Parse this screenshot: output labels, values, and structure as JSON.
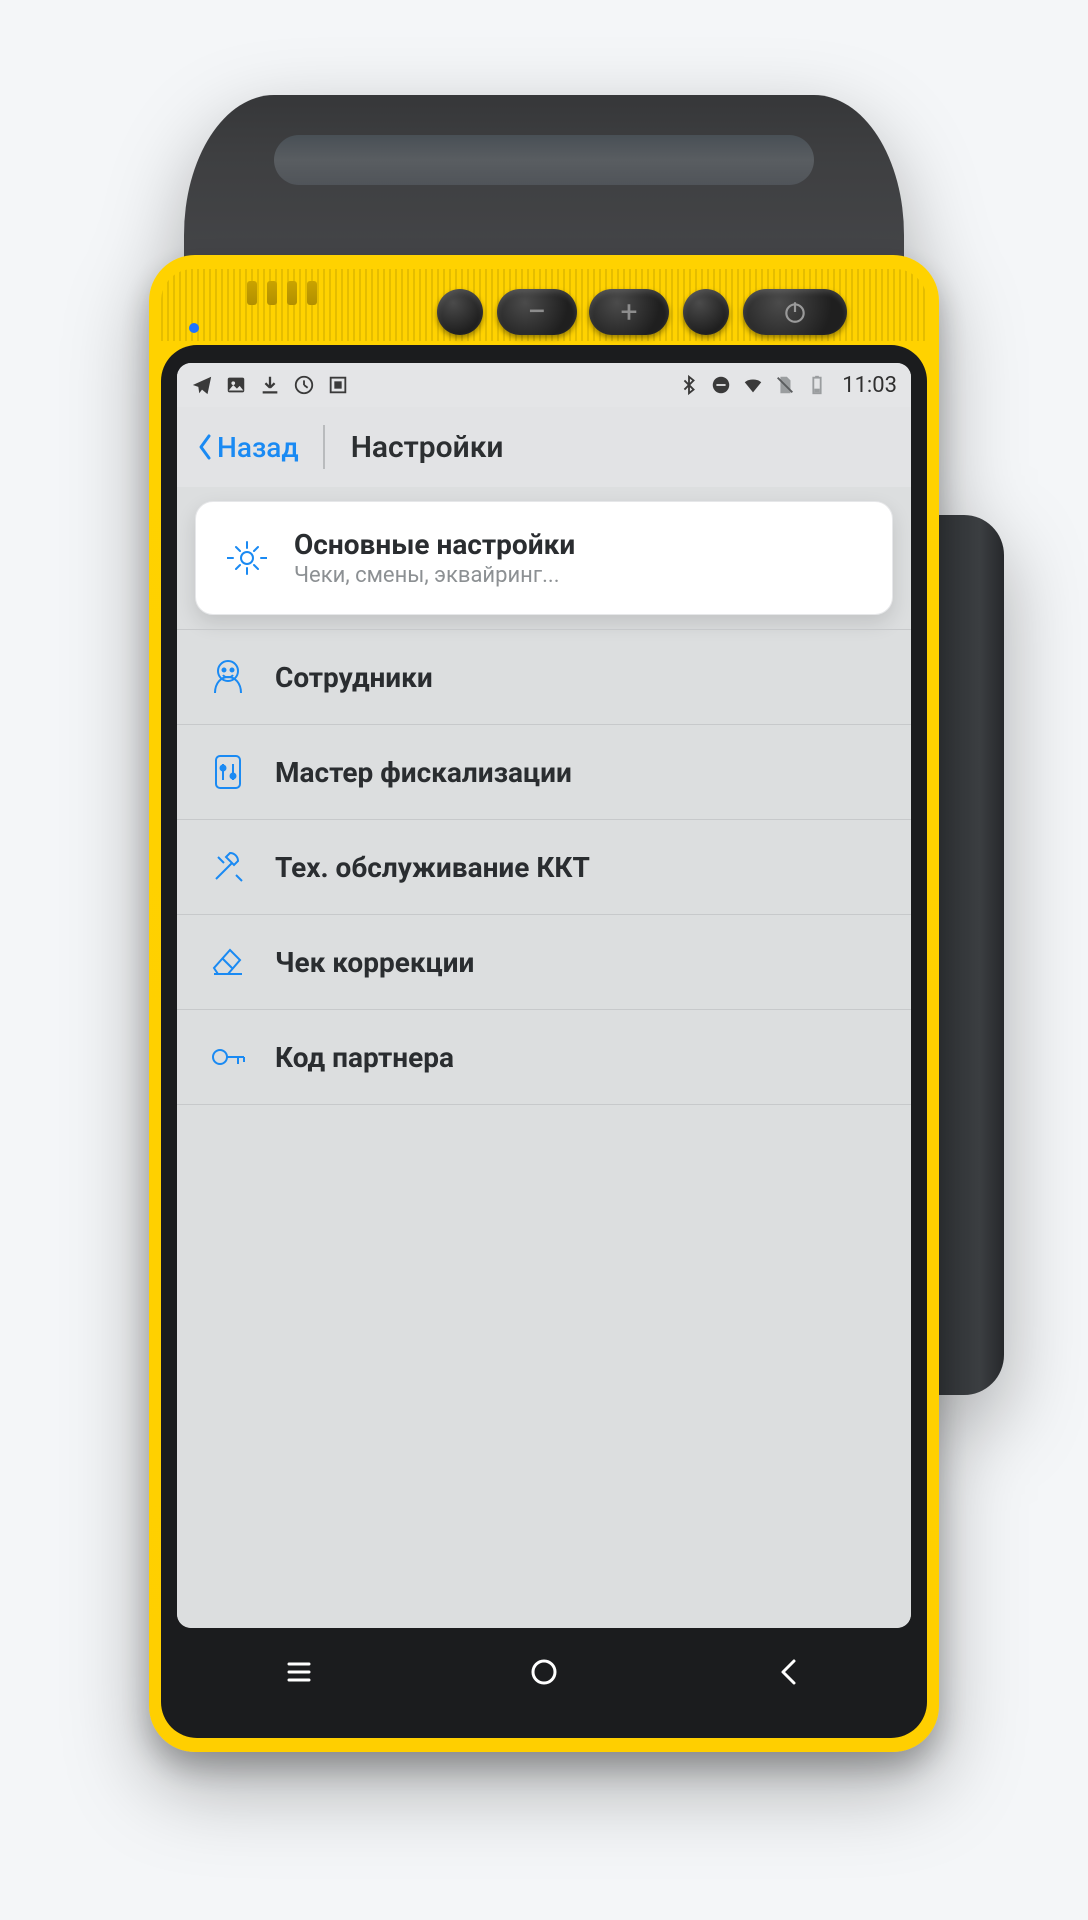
{
  "status_bar": {
    "time": "11:03"
  },
  "header": {
    "back_label": "Назад",
    "title": "Настройки"
  },
  "settings": [
    {
      "title": "Основные настройки",
      "subtitle": "Чеки, смены, эквайринг...",
      "highlighted": true
    },
    {
      "title": "Сотрудники"
    },
    {
      "title": "Мастер фискализации"
    },
    {
      "title": "Тех. обслуживание ККТ"
    },
    {
      "title": "Чек коррекции"
    },
    {
      "title": "Код партнера"
    }
  ],
  "hardware_buttons": {
    "minus": "−",
    "plus": "+"
  }
}
